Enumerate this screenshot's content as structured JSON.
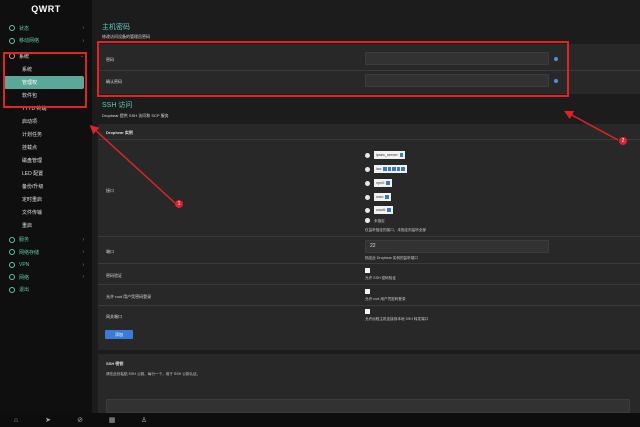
{
  "brand": "QWRT",
  "sidebar": {
    "items": [
      {
        "label": "状态",
        "green": true
      },
      {
        "label": "移动网络",
        "green": true
      },
      {
        "label": "系统",
        "green": false
      }
    ],
    "sub_items": [
      "系统",
      "管理权",
      "软件包",
      "TTYD 终端",
      "启动项",
      "计划任务",
      "挂载点",
      "磁盘管理",
      "LED 配置",
      "备份/升级",
      "定时重启",
      "文件传输",
      "重启"
    ],
    "lower_items": [
      {
        "label": "服务"
      },
      {
        "label": "网络存储"
      },
      {
        "label": "VPN"
      },
      {
        "label": "网络"
      },
      {
        "label": "退出"
      }
    ]
  },
  "main": {
    "password_section": {
      "title": "主机密码",
      "desc": "修改访问设备的管理员密码",
      "label_password": "密码",
      "label_confirm": "确认密码"
    },
    "ssh_section": {
      "title": "SSH 访问",
      "desc": "Dropbear 提供 SSH 访问和 SCP 服务",
      "instance_label": "Dropbear 实例",
      "interface_label": "接口",
      "interfaces": [
        {
          "label": "ipsec_server:"
        },
        {
          "label": "lan:"
        },
        {
          "label": "vpn0:"
        },
        {
          "label": "wan:"
        },
        {
          "label": "wan6:"
        }
      ],
      "unspecified": "未指定",
      "interface_hint": "仅监听指定的接口，未指定则监听全部",
      "port_label": "端口",
      "port_value": "22",
      "port_hint": "指定此 Dropbear 实例的监听端口",
      "pwd_auth_label": "密码验证",
      "pwd_auth_hint": "允许 SSH 密码验证",
      "root_pwd_label": "允许 root 用户凭密码登录",
      "root_pwd_hint": "允许 root 用户凭密码登录",
      "gateway_label": "网关端口",
      "gateway_hint": "允许远程主机连接到本地 SSH 转发端口",
      "add_button": "添加"
    },
    "keys_section": {
      "title": "SSH 密钥",
      "desc": "请在此处粘贴 SSH 公钥，每行一个，用于 SSH 公钥认证。"
    }
  },
  "annotations": {
    "badge1": "1",
    "badge2": "2"
  },
  "colors": {
    "accent": "#5fc8c0",
    "active": "#5aa897",
    "annotation": "#e02424",
    "button": "#3a7bd5"
  }
}
